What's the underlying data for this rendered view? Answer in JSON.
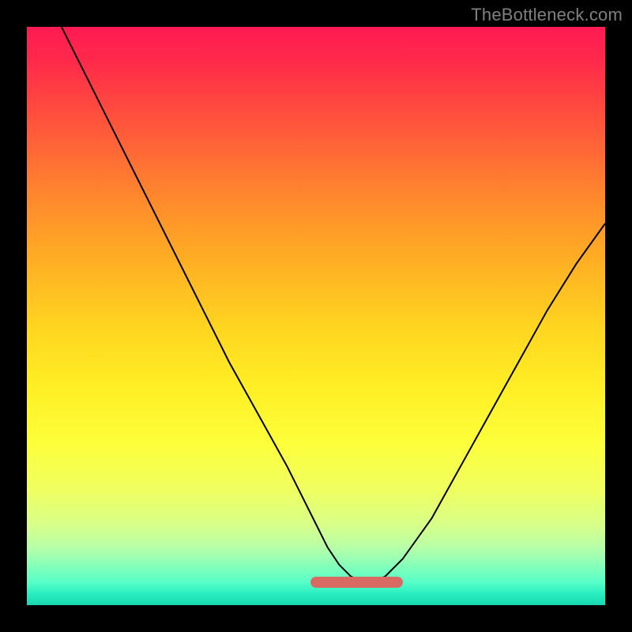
{
  "watermark": "TheBottleneck.com",
  "colors": {
    "page_bg": "#000000",
    "watermark": "#808080",
    "curve": "#000000",
    "marker": "#d96a63",
    "gradient_top": "#ff1a52",
    "gradient_mid": "#ffd520",
    "gradient_bottom": "#18d8b0"
  },
  "chart_data": {
    "type": "line",
    "title": "",
    "xlabel": "",
    "ylabel": "",
    "xlim": [
      0,
      100
    ],
    "ylim": [
      0,
      100
    ],
    "series": [
      {
        "name": "bottleneck-curve",
        "x": [
          6,
          10,
          15,
          20,
          25,
          30,
          35,
          40,
          45,
          50,
          52,
          54,
          56,
          58,
          60,
          62,
          65,
          70,
          75,
          80,
          85,
          90,
          95,
          100
        ],
        "y": [
          100,
          92,
          82,
          72,
          62,
          52,
          42,
          33,
          24,
          14,
          10,
          7,
          5,
          4,
          4,
          5,
          8,
          15,
          24,
          33,
          42,
          51,
          59,
          66
        ]
      }
    ],
    "annotations": [
      {
        "name": "optimal-range-marker",
        "x_start": 49,
        "x_end": 65,
        "y": 4
      }
    ],
    "gradient_stops": [
      {
        "pct": 0,
        "color": "#ff1a52"
      },
      {
        "pct": 40,
        "color": "#ffad24"
      },
      {
        "pct": 72,
        "color": "#fcff3a"
      },
      {
        "pct": 100,
        "color": "#18d8b0"
      }
    ]
  }
}
